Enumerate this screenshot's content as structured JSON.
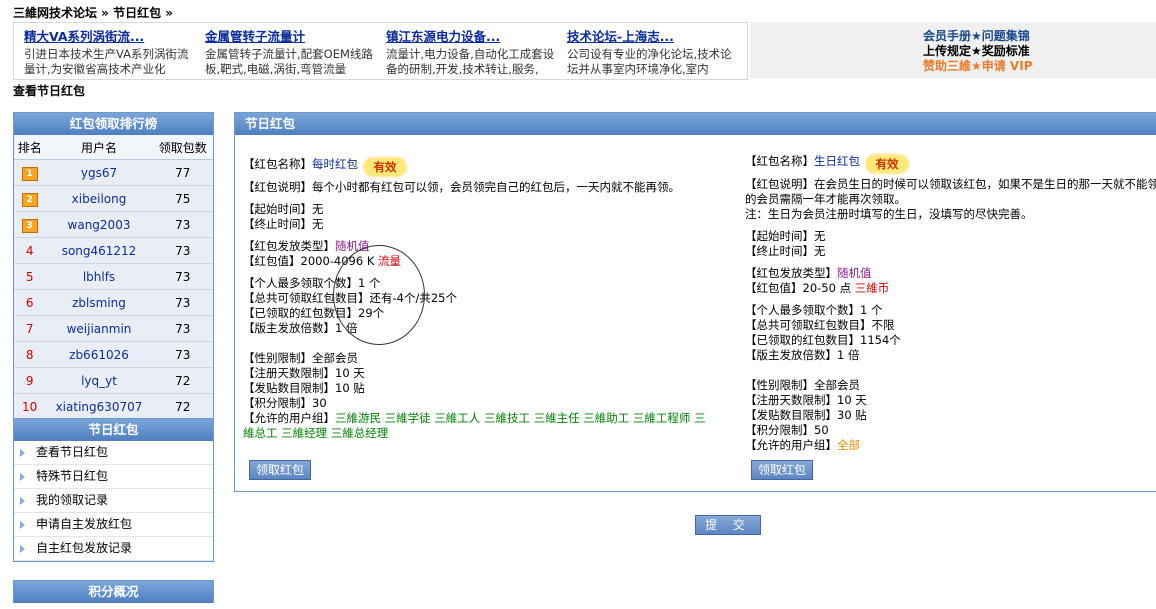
{
  "breadcrumb": "三維网技术论坛 » 节日红包 »",
  "ads": [
    {
      "title": "精大VA系列涡街流...",
      "desc": "引进日本技术生产VA系列涡街流量计,为安徽省高技术产业化"
    },
    {
      "title": "金属管转子流量计",
      "desc": "金属管转子流量计,配套OEM线路板,靶式,电磁,涡街,弯管流量"
    },
    {
      "title": "镇江东源电力设备...",
      "desc": "流量计,电力设备,自动化工成套设备的研制,开发,技术转让,服务,"
    },
    {
      "title": "技术论坛-上海志...",
      "desc": "公司设有专业的净化论坛,技术论坛并从事室内环境净化,室内"
    }
  ],
  "top_links": [
    "会员手册★问题集锦",
    "上传规定★奖励标准",
    "赞助三維★申请 VIP"
  ],
  "page_subtitle": "查看节日红包",
  "ranking": {
    "title": "红包领取排行榜",
    "headers": [
      "排名",
      "用户名",
      "领取包数"
    ],
    "rows": [
      {
        "rank": "1",
        "user": "ygs67",
        "count": "77"
      },
      {
        "rank": "2",
        "user": "xibeilong",
        "count": "75"
      },
      {
        "rank": "3",
        "user": "wang2003",
        "count": "73"
      },
      {
        "rank": "4",
        "user": "song461212",
        "count": "73"
      },
      {
        "rank": "5",
        "user": "lbhlfs",
        "count": "73"
      },
      {
        "rank": "6",
        "user": "zblsming",
        "count": "73"
      },
      {
        "rank": "7",
        "user": "weijianmin",
        "count": "73"
      },
      {
        "rank": "8",
        "user": "zb661026",
        "count": "73"
      },
      {
        "rank": "9",
        "user": "lyq_yt",
        "count": "72"
      },
      {
        "rank": "10",
        "user": "xiating630707",
        "count": "72"
      }
    ]
  },
  "menu": {
    "title": "节日红包",
    "items": [
      "查看节日红包",
      "特殊节日红包",
      "我的领取记录",
      "申请自主发放红包",
      "自主红包发放记录"
    ]
  },
  "points_panel_title": "积分概况",
  "main_title": "节日红包",
  "valid_badge": "有效",
  "left": {
    "name_label": "【红包名称】",
    "name": "每时红包",
    "desc_label": "【红包说明】",
    "desc": "每个小时都有红包可以领，会员领完自己的红包后，一天内就不能再领。",
    "start_label": "【起始时间】",
    "start": "无",
    "end_label": "【终止时间】",
    "end": "无",
    "type_label": "【红包发放类型】",
    "type": "随机值",
    "value_label": "【红包值】",
    "value": "2000-4096 K",
    "value_unit": "流量",
    "max_label": "【个人最多领取个数】",
    "max": "1 个",
    "total_label": "【总共可领取红包数目】",
    "total": "还有-4个/共25个",
    "claimed_label": "【已领取的红包数目】",
    "claimed": "29个",
    "multiple_label": "【版主发放倍数】",
    "multiple": "1 倍",
    "gender_label": "【性别限制】",
    "gender": "全部会员",
    "days_label": "【注册天数限制】",
    "days": "10 天",
    "posts_label": "【发贴数目限制】",
    "posts": "10 贴",
    "points_label": "【积分限制】",
    "points": "30",
    "groups_label": "【允许的用户组】",
    "groups": "三維游民 三維学徒 三維工人 三維技工 三維主任 三維助工 三維工程师 三維总工 三維经理 三維总经理",
    "button": "领取红包"
  },
  "right": {
    "name_label": "【红包名称】",
    "name": "生日红包",
    "desc_label": "【红包说明】",
    "desc": "在会员生日的时候可以领取该红包，如果不是生日的那一天就不能领的会员需隔一年才能再次领取。",
    "note": "注：生日为会员注册时填写的生日，没填写的尽快完善。",
    "start_label": "【起始时间】",
    "start": "无",
    "end_label": "【终止时间】",
    "end": "无",
    "type_label": "【红包发放类型】",
    "type": "随机值",
    "value_label": "【红包值】",
    "value": "20-50 点",
    "value_unit": "三維币",
    "max_label": "【个人最多领取个数】",
    "max": "1 个",
    "total_label": "【总共可领取红包数目】",
    "total": "不限",
    "claimed_label": "【已领取的红包数目】",
    "claimed": "1154个",
    "multiple_label": "【版主发放倍数】",
    "multiple": "1 倍",
    "gender_label": "【性别限制】",
    "gender": "全部会员",
    "days_label": "【注册天数限制】",
    "days": "10 天",
    "posts_label": "【发贴数目限制】",
    "posts": "30 贴",
    "points_label": "【积分限制】",
    "points": "50",
    "groups_label": "【允许的用户组】",
    "groups": "全部",
    "button": "领取红包"
  },
  "submit": "提 交"
}
